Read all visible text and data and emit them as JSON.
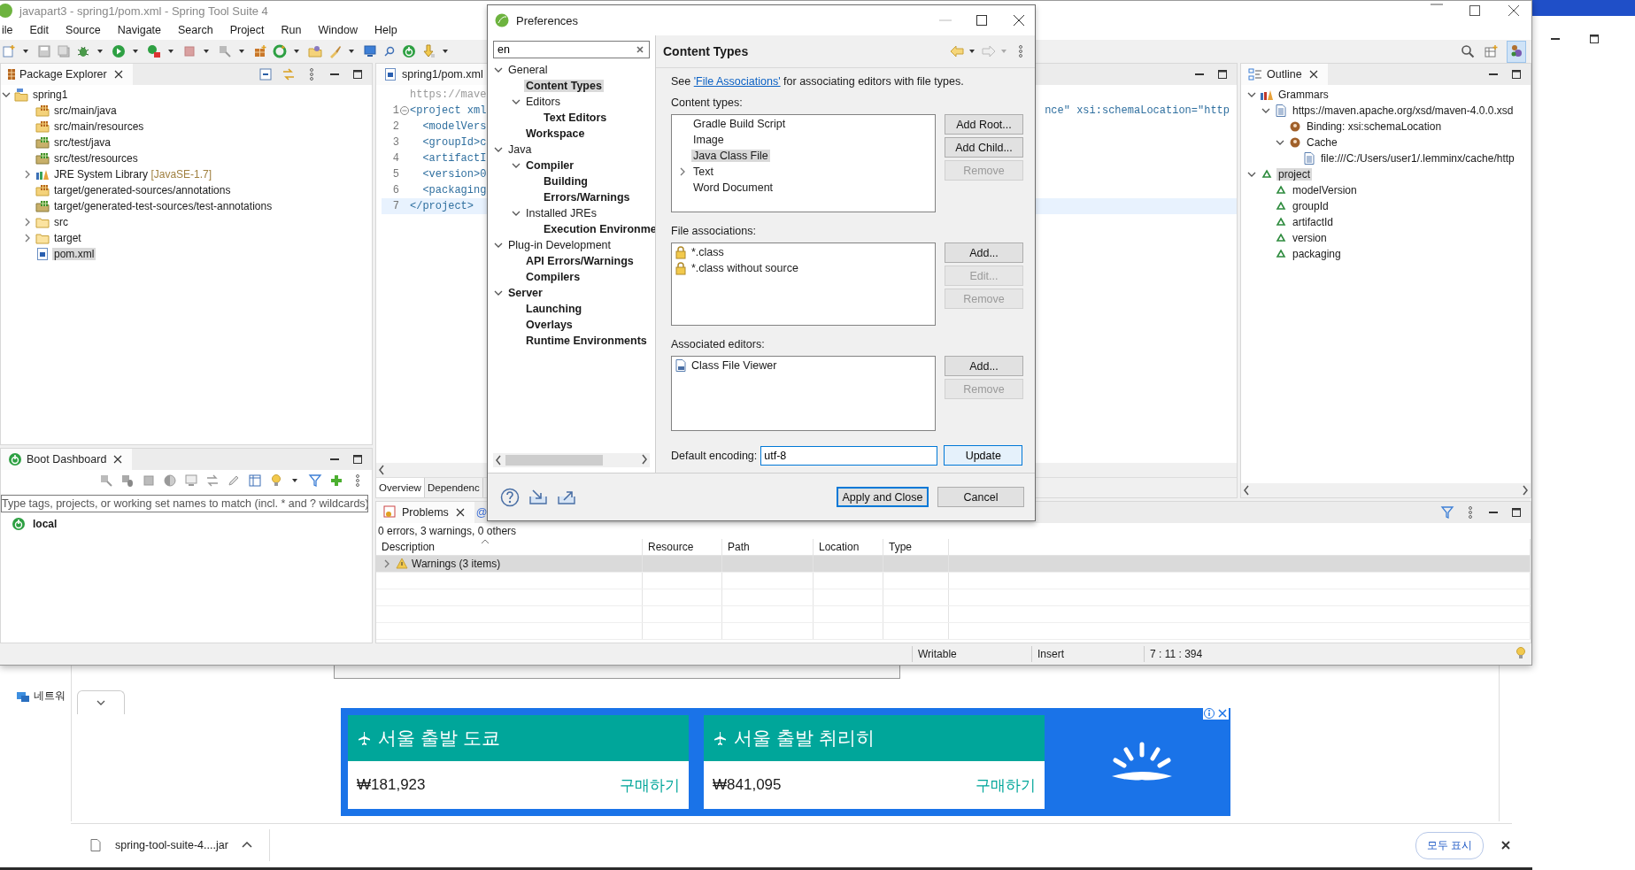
{
  "ide": {
    "title": "javapart3 - spring1/pom.xml - Spring Tool Suite 4",
    "menu": [
      "ile",
      "Edit",
      "Source",
      "Navigate",
      "Search",
      "Project",
      "Run",
      "Window",
      "Help"
    ],
    "package_explorer": {
      "tab": "Package Explorer",
      "tree": [
        {
          "label": "spring1",
          "kind": "project",
          "selected": false,
          "expanded": true,
          "children": [
            {
              "label": "src/main/java",
              "kind": "source",
              "selected": false
            },
            {
              "label": "src/main/resources",
              "kind": "source",
              "selected": false
            },
            {
              "label": "src/test/java",
              "kind": "test-source",
              "selected": false
            },
            {
              "label": "src/test/resources",
              "kind": "test-source",
              "selected": false
            },
            {
              "label": "JRE System Library",
              "decoration": "[JavaSE-1.7]",
              "kind": "library",
              "selected": false,
              "expanded": false
            },
            {
              "label": "target/generated-sources/annotations",
              "kind": "source",
              "selected": false
            },
            {
              "label": "target/generated-test-sources/test-annotations",
              "kind": "test-source",
              "selected": false
            },
            {
              "label": "src",
              "kind": "folder",
              "selected": false,
              "expanded": false
            },
            {
              "label": "target",
              "kind": "folder",
              "selected": false,
              "expanded": false
            },
            {
              "label": "pom.xml",
              "kind": "maven-file",
              "selected": true
            }
          ]
        }
      ]
    },
    "editor": {
      "tab": "spring1/pom.xml",
      "lines": [
        {
          "fold": false,
          "text": "https://mave",
          "kind": "url",
          "current": false
        },
        {
          "number": "1",
          "fold": true,
          "text": "<project xml",
          "tail": "nce\" xsi:schemaLocation=\"http",
          "kind": "tag",
          "current": false
        },
        {
          "number": "2",
          "fold": false,
          "text": "  <modelVers",
          "kind": "tag",
          "current": false
        },
        {
          "number": "3",
          "fold": false,
          "text": "  <groupId>c",
          "kind": "tag",
          "current": false
        },
        {
          "number": "4",
          "fold": false,
          "text": "  <artifactI",
          "kind": "tag",
          "current": false
        },
        {
          "number": "5",
          "fold": false,
          "text": "  <version>0",
          "kind": "tag",
          "current": false
        },
        {
          "number": "6",
          "fold": false,
          "text": "  <packaging",
          "kind": "tag",
          "current": false
        },
        {
          "number": "7",
          "fold": false,
          "text": "</project>",
          "kind": "tag",
          "current": true
        }
      ],
      "bottom_tabs": [
        {
          "label": "Overview",
          "selected": true
        },
        {
          "label": "Dependenc",
          "selected": false
        }
      ]
    },
    "boot_dashboard": {
      "tab": "Boot Dashboard",
      "filter_placeholder": "Type tags, projects, or working set names to match (incl. * and ? wildcards)",
      "items": [
        {
          "label": "local",
          "selected": false
        }
      ]
    },
    "outline": {
      "tab": "Outline",
      "tree": [
        {
          "label": "Grammars",
          "kind": "grammars",
          "selected": false,
          "expanded": true,
          "children": [
            {
              "label": "https://maven.apache.org/xsd/maven-4.0.0.xsd",
              "kind": "page",
              "selected": false,
              "expanded": true,
              "children": [
                {
                  "label": "Binding: xsi:schemaLocation",
                  "kind": "binding",
                  "selected": false
                },
                {
                  "label": "Cache",
                  "kind": "binding",
                  "selected": false,
                  "expanded": true,
                  "children": [
                    {
                      "label": "file:///C:/Users/user1/.lemminx/cache/http",
                      "kind": "page",
                      "selected": false
                    }
                  ]
                }
              ]
            }
          ]
        },
        {
          "label": "project",
          "kind": "element",
          "selected": true,
          "expanded": true,
          "children": [
            {
              "label": "modelVersion",
              "kind": "element",
              "selected": false
            },
            {
              "label": "groupId",
              "kind": "element",
              "selected": false
            },
            {
              "label": "artifactId",
              "kind": "element",
              "selected": false
            },
            {
              "label": "version",
              "kind": "element",
              "selected": false
            },
            {
              "label": "packaging",
              "kind": "element",
              "selected": false
            }
          ]
        }
      ]
    },
    "problems": {
      "tabs": [
        {
          "label": "Problems",
          "selected": true
        },
        {
          "label": "@",
          "selected": false
        }
      ],
      "summary": "0 errors, 3 warnings, 0 others",
      "columns": [
        "Description",
        "Resource",
        "Path",
        "Location",
        "Type"
      ],
      "rows": [
        {
          "description": "Warnings (3 items)",
          "expanded": false,
          "selected": true
        }
      ]
    },
    "status": [
      "Writable",
      "Insert",
      "7 : 11 : 394"
    ]
  },
  "preferences": {
    "title": "Preferences",
    "filter": "en",
    "tree": [
      {
        "label": "General",
        "matched": false,
        "selected": false,
        "expanded": true,
        "children": [
          {
            "label": "Content Types",
            "matched": true,
            "selected": true
          },
          {
            "label": "Editors",
            "matched": false,
            "selected": false,
            "expanded": true,
            "children": [
              {
                "label": "Text Editors",
                "matched": true,
                "selected": false
              }
            ]
          },
          {
            "label": "Workspace",
            "matched": true,
            "selected": false
          }
        ]
      },
      {
        "label": "Java",
        "matched": false,
        "selected": false,
        "expanded": true,
        "children": [
          {
            "label": "Compiler",
            "matched": true,
            "selected": false,
            "expanded": true,
            "children": [
              {
                "label": "Building",
                "matched": true,
                "selected": false
              },
              {
                "label": "Errors/Warnings",
                "matched": true,
                "selected": false
              }
            ]
          },
          {
            "label": "Installed JREs",
            "matched": false,
            "selected": false,
            "expanded": true,
            "children": [
              {
                "label": "Execution Environme",
                "matched": true,
                "selected": false
              }
            ]
          }
        ]
      },
      {
        "label": "Plug-in Development",
        "matched": false,
        "selected": false,
        "expanded": true,
        "children": [
          {
            "label": "API Errors/Warnings",
            "matched": true,
            "selected": false
          },
          {
            "label": "Compilers",
            "matched": true,
            "selected": false
          }
        ]
      },
      {
        "label": "Server",
        "matched": true,
        "selected": false,
        "expanded": true,
        "children": [
          {
            "label": "Launching",
            "matched": true,
            "selected": false
          },
          {
            "label": "Overlays",
            "matched": true,
            "selected": false
          },
          {
            "label": "Runtime Environments",
            "matched": true,
            "selected": false
          }
        ]
      }
    ],
    "page_title": "Content Types",
    "description": {
      "before": "See ",
      "link": "'File Associations'",
      "after": " for associating editors with file types."
    },
    "sections": [
      {
        "label": "Content types:",
        "items": [
          {
            "label": "Gradle Build Script",
            "selected": false
          },
          {
            "label": "Image",
            "selected": false
          },
          {
            "label": "Java Class File",
            "selected": true
          },
          {
            "label": "Text",
            "selected": false,
            "expanded": false
          },
          {
            "label": "Word Document",
            "selected": false
          }
        ],
        "buttons": [
          {
            "label": "Add Root...",
            "disabled": false
          },
          {
            "label": "Add Child...",
            "disabled": false
          },
          {
            "label": "Remove",
            "disabled": true
          }
        ]
      },
      {
        "label": "File associations:",
        "items": [
          {
            "label": "*.class",
            "selected": false,
            "kind": "locked"
          },
          {
            "label": "*.class without source",
            "selected": false,
            "kind": "locked"
          }
        ],
        "buttons": [
          {
            "label": "Add...",
            "disabled": false
          },
          {
            "label": "Edit...",
            "disabled": true
          },
          {
            "label": "Remove",
            "disabled": true
          }
        ]
      },
      {
        "label": "Associated editors:",
        "items": [
          {
            "label": "Class File Viewer",
            "selected": false,
            "kind": "viewer"
          }
        ],
        "buttons": [
          {
            "label": "Add...",
            "disabled": false
          },
          {
            "label": "Remove",
            "disabled": true
          }
        ]
      }
    ],
    "encoding": {
      "label": "Default encoding:",
      "value": "utf-8",
      "button": "Update"
    },
    "apply": "Apply and Close",
    "cancel": "Cancel"
  },
  "browser": {
    "sidebar_item": "네트워",
    "ad": {
      "cards": [
        {
          "title": "서울 출발 도쿄",
          "price": "₩181,923",
          "action": "구매하기"
        },
        {
          "title": "서울 출발 취리히",
          "price": "₩841,095",
          "action": "구매하기"
        }
      ]
    },
    "download": {
      "file": "spring-tool-suite-4....jar",
      "show_all": "모두 표시"
    }
  }
}
